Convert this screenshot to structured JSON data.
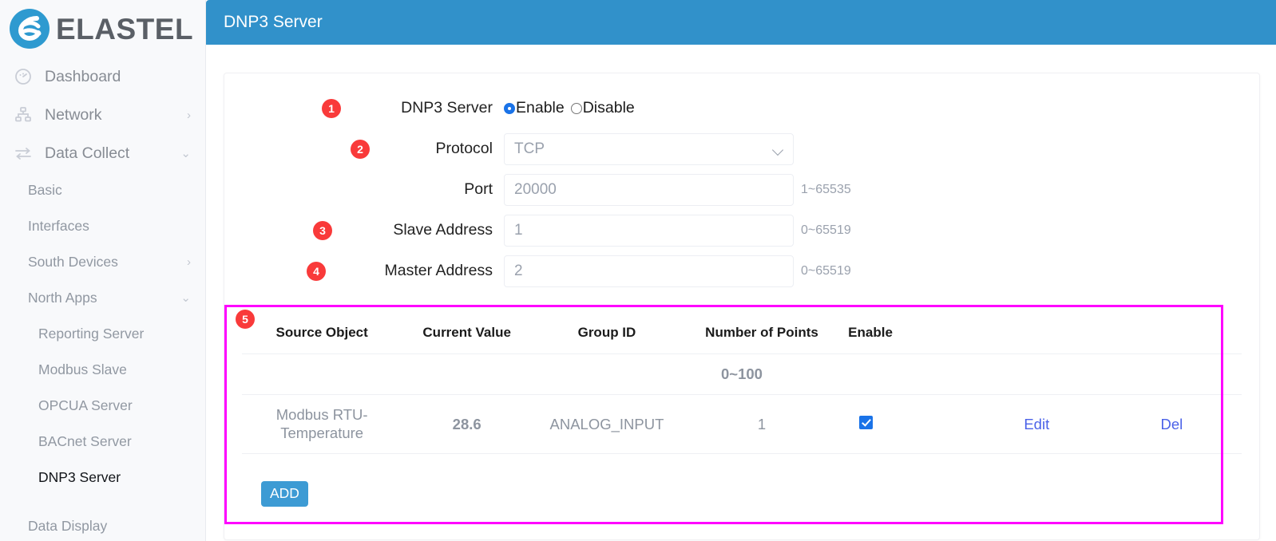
{
  "brand": {
    "name": "ELASTEL"
  },
  "sidebar": {
    "items": [
      {
        "label": "Dashboard",
        "icon": "dashboard-icon",
        "chevron": "",
        "level": "top"
      },
      {
        "label": "Network",
        "icon": "network-icon",
        "chevron": "›",
        "level": "top"
      },
      {
        "label": "Data Collect",
        "icon": "data-collect-icon",
        "chevron": "⌄",
        "level": "top"
      },
      {
        "label": "Basic",
        "icon": "",
        "chevron": "",
        "level": "sub"
      },
      {
        "label": "Interfaces",
        "icon": "",
        "chevron": "",
        "level": "sub"
      },
      {
        "label": "South Devices",
        "icon": "",
        "chevron": "›",
        "level": "sub"
      },
      {
        "label": "North Apps",
        "icon": "",
        "chevron": "⌄",
        "level": "sub"
      },
      {
        "label": "Reporting Server",
        "icon": "",
        "chevron": "",
        "level": "sub2"
      },
      {
        "label": "Modbus Slave",
        "icon": "",
        "chevron": "",
        "level": "sub2"
      },
      {
        "label": "OPCUA Server",
        "icon": "",
        "chevron": "",
        "level": "sub2"
      },
      {
        "label": "BACnet Server",
        "icon": "",
        "chevron": "",
        "level": "sub2"
      },
      {
        "label": "DNP3 Server",
        "icon": "",
        "chevron": "",
        "level": "sub2",
        "active": true
      },
      {
        "label": "Data Display",
        "icon": "",
        "chevron": "",
        "level": "sub"
      }
    ]
  },
  "topbar": {
    "title": "DNP3 Server"
  },
  "form": {
    "dnp3_server": {
      "badge": "1",
      "label": "DNP3 Server",
      "enable_label": "Enable",
      "disable_label": "Disable",
      "selected": "Enable"
    },
    "protocol": {
      "badge": "2",
      "label": "Protocol",
      "value": "TCP",
      "options": [
        "TCP"
      ],
      "hint": ""
    },
    "port": {
      "badge": "",
      "label": "Port",
      "value": "20000",
      "hint": "1~65535"
    },
    "slave_address": {
      "badge": "3",
      "label": "Slave Address",
      "value": "1",
      "hint": "0~65519"
    },
    "master_address": {
      "badge": "4",
      "label": "Master Address",
      "value": "2",
      "hint": "0~65519"
    }
  },
  "table": {
    "badge": "5",
    "headers": [
      "Source Object",
      "Current Value",
      "Group ID",
      "Number of Points",
      "Enable",
      "",
      ""
    ],
    "range_row": "0~100",
    "rows": [
      {
        "source_object": "Modbus RTU-Temperature",
        "current_value": "28.6",
        "group_id": "ANALOG_INPUT",
        "number_of_points": "1",
        "enabled": true,
        "edit_label": "Edit",
        "del_label": "Del"
      }
    ],
    "add_label": "ADD"
  },
  "colors": {
    "topbar_blue": "#3191ca",
    "badge_red": "#f93a3a",
    "highlight_magenta": "#ff00ff",
    "value_blue": "#1f44d8",
    "link_blue": "#4b62e8",
    "checkbox_blue": "#1a73e8",
    "add_button_blue": "#3d9bd4"
  }
}
